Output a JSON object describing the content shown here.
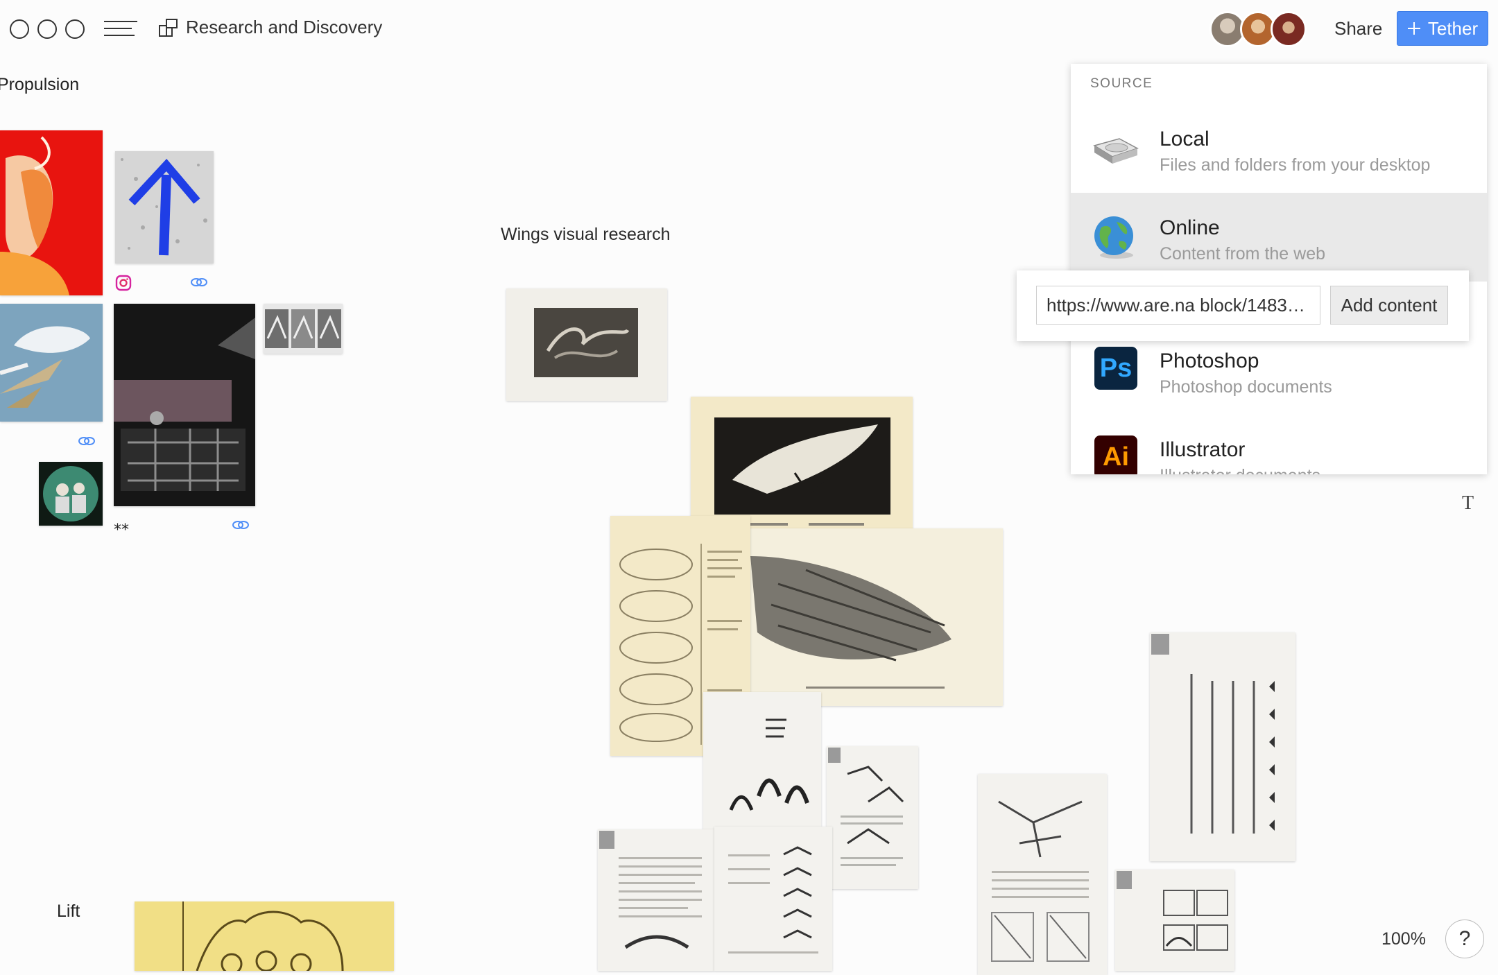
{
  "window": {
    "title": "Research and Discovery"
  },
  "header": {
    "share_label": "Share",
    "tether_label": "Tether",
    "tether_icon": "plus-icon",
    "collaborators": [
      {
        "name": "collaborator-1",
        "color": "#8a7d70"
      },
      {
        "name": "collaborator-2",
        "color": "#b3652e"
      },
      {
        "name": "collaborator-3",
        "color": "#7a2a22"
      }
    ]
  },
  "canvas": {
    "sections": {
      "propulsion": "Propulsion",
      "wings": "Wings visual research",
      "lift": "Lift"
    },
    "caption_stars": "⁎⁎"
  },
  "source_menu": {
    "header": "SOURCE",
    "items": [
      {
        "title": "Local",
        "subtitle": "Files and folders from your desktop",
        "icon": "hard-drive-icon"
      },
      {
        "title": "Online",
        "subtitle": "Content from the web",
        "icon": "globe-icon"
      },
      {
        "title": "Photoshop",
        "subtitle": "Photoshop documents",
        "icon": "photoshop-icon"
      },
      {
        "title": "Illustrator",
        "subtitle": "Illustrator documents",
        "icon": "illustrator-icon"
      }
    ],
    "ps_glyph": "Ps",
    "ai_glyph": "Ai"
  },
  "url_popover": {
    "value": "https://www.are.na block/1483…",
    "add_label": "Add content"
  },
  "footer": {
    "zoom": "100%",
    "help": "?"
  },
  "colors": {
    "accent": "#4f8ef7",
    "link_icon": "#4f8ef7",
    "ps_bg": "#0a2540",
    "ps_fg": "#31a8ff",
    "ai_bg": "#330000",
    "ai_fg": "#ff9a00"
  }
}
